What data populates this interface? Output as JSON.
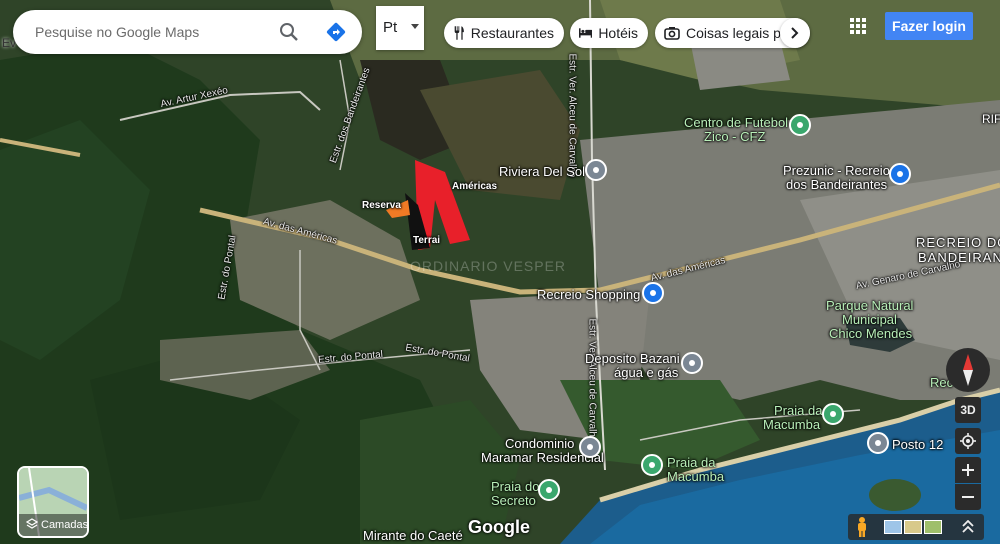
{
  "search": {
    "placeholder": "Pesquise no Google Maps"
  },
  "language_selector": {
    "value": "Pt"
  },
  "chips": {
    "restaurants": "Restaurantes",
    "hotels": "Hotéis",
    "things_to_do": "Coisas legais pa"
  },
  "login_label": "Fazer login",
  "layers_label": "Camadas",
  "controls": {
    "three_d": "3D"
  },
  "branding": "Google",
  "overlay": {
    "americas_label": "Américas",
    "reserva_label": "Reserva",
    "terrain_label": "Terrai",
    "colors": {
      "red": "#e8202a",
      "orange": "#f07a25",
      "black": "#111111"
    }
  },
  "map_labels": {
    "ev_edge": "Ev",
    "rif_edge": "RIF",
    "artur_xexeo": "Av. Artur Xexéo",
    "estr_bandeirantes": "Estr. dos Bandeirantes",
    "estr_pontal_left": "Estr. do Pontal",
    "estr_pontal_center": "Estr. do Pontal",
    "estr_pontal_bottom": "Estr. do Pontal",
    "av_americas_left": "Av. das Américas",
    "av_americas_right": "Av. das Américas",
    "estr_vereador": "Estr. Ver. Alceu de Carvalho",
    "estr_vereador_south": "Estr. Ver. Alceu de Carvalho",
    "av_genaro": "Av. Genaro de Carvalho",
    "riviera": "Riviera Del Sol",
    "centro_futebol_1": "Centro de Futebol",
    "centro_futebol_2": "Zico - CFZ",
    "prezunic_1": "Prezunic - Recreio",
    "prezunic_2": "dos Bandeirantes",
    "recreio_shopping": "Recreio Shopping",
    "recreio_bandeirantes_1": "RECREIO DOS",
    "recreio_bandeirantes_2": "BANDEIRANTES",
    "parque_1": "Parque Natural",
    "parque_2": "Municipal",
    "parque_3": "Chico Mendes",
    "deposito_1": "Deposito Bazani",
    "deposito_2": "água e gás",
    "condominio_1": "Condominio",
    "condominio_2": "Maramar Residencial",
    "praia_macumba_1": "Praia da",
    "praia_macumba_2": "Macumba",
    "praia_macumba_b1": "Praia da",
    "praia_macumba_b2": "Macumba",
    "praia_secreto_1": "Praia do",
    "praia_secreto_2": "Secreto",
    "posto_12": "Posto 12",
    "mirante": "Mirante do Caeté",
    "recreio_edge": "Rec",
    "watermark": "ORDINARIO VESPER"
  },
  "colors": {
    "login_bg": "#4285f4",
    "pin_blue": "#1a73e8",
    "pin_green": "#3aa76d",
    "pin_gray": "#7b8794"
  }
}
